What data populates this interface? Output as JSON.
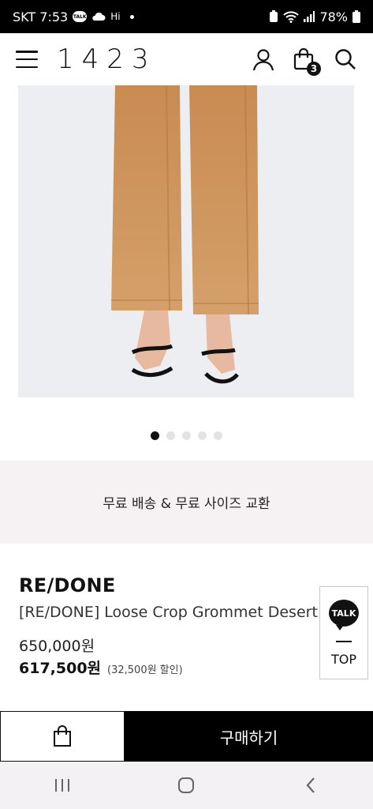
{
  "status_bar": {
    "carrier_time": "SKT 7:53",
    "talk_icon_text": "TALK",
    "hi_label": "Hi",
    "battery": "78%"
  },
  "header": {
    "logo": "1423",
    "cart_count": "3"
  },
  "carousel": {
    "total_dots": 5,
    "active_index": 0
  },
  "banner": {
    "text": "무료 배송 & 무료 사이즈 교환"
  },
  "product": {
    "brand": "RE/DONE",
    "name": "[RE/DONE] Loose Crop Grommet Desert",
    "original_price": "650,000원",
    "sale_price": "617,500원",
    "discount": "(32,500원 할인)"
  },
  "floating": {
    "talk_label": "TALK",
    "top_label": "TOP"
  },
  "bottom_bar": {
    "buy_label": "구매하기"
  },
  "colors": {
    "denim": "#c8905a",
    "banner_bg": "#f6f1f2",
    "accent": "#000000"
  }
}
